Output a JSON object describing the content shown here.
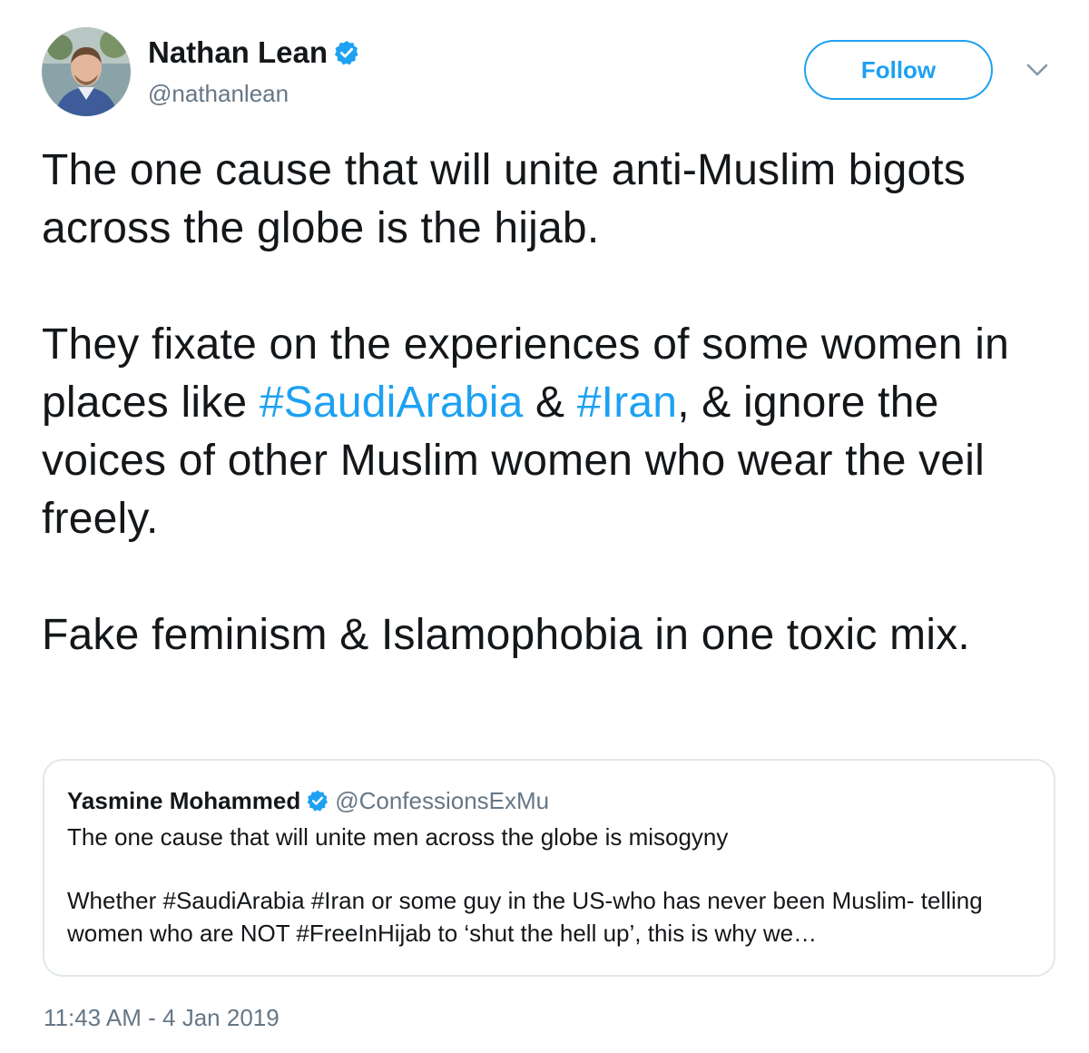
{
  "author": {
    "display_name": "Nathan Lean",
    "handle": "@nathanlean",
    "avatar_icon": "profile-photo",
    "verified_icon": "verified-badge-icon"
  },
  "actions": {
    "follow_label": "Follow",
    "menu_icon": "chevron-down-icon"
  },
  "tweet": {
    "para1": "The one cause that will unite anti-Muslim bigots across the globe is the hijab.",
    "para2_a": "They fixate on the experiences of some women in places like ",
    "para2_tag1": "#SaudiArabia",
    "para2_b": " & ",
    "para2_tag2": "#Iran",
    "para2_c": ", & ignore the voices of other Muslim women who wear the veil freely.",
    "para3": "Fake feminism & Islamophobia in one toxic mix."
  },
  "quote": {
    "display_name": "Yasmine Mohammed",
    "handle": "@ConfessionsExMu",
    "line1": "The one cause that will unite men across the globe is misogyny",
    "line2": "Whether #SaudiArabia #Iran or some guy in the US-who has never been Muslim- telling women who are NOT #FreeInHijab to ‘shut the hell up’, this is why we…"
  },
  "timestamp": "11:43 AM - 4 Jan 2019",
  "colors": {
    "accent": "#1da1f2",
    "text": "#14171a",
    "secondary": "#657786",
    "border": "#e1e8ed"
  }
}
